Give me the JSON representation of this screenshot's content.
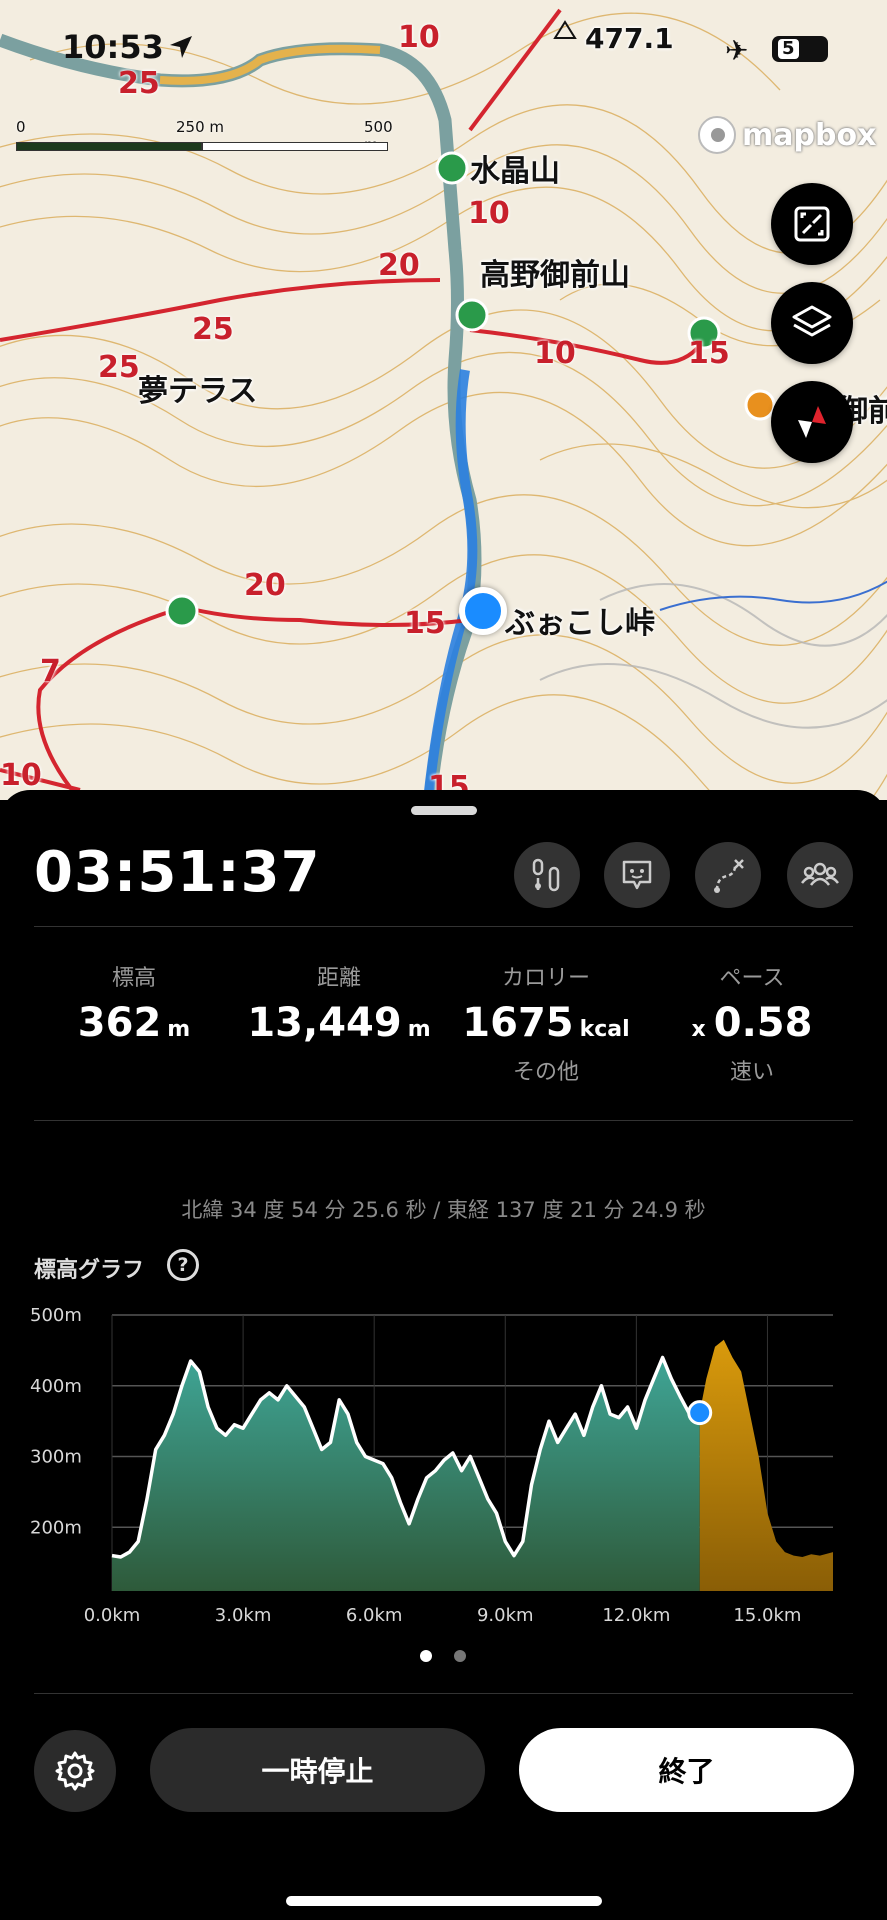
{
  "status_bar": {
    "time": "10:53",
    "battery": "5"
  },
  "map": {
    "scale": {
      "tick_0": "0",
      "tick_250": "250 m",
      "tick_500": "500 m"
    },
    "attribution": "mapbox",
    "peak_elevation": "477.1",
    "places": {
      "suisho_yama": "水晶山",
      "koya_gozen_yama": "高野御前山",
      "yume_terrace": "夢テラス",
      "bukkoshi_toge": "ぶぉこし峠",
      "edge_label": "高野御前"
    },
    "trail_times": [
      "25",
      "10",
      "10",
      "20",
      "25",
      "25",
      "10",
      "15",
      "20",
      "15",
      "7",
      "10",
      "15"
    ],
    "buttons": {
      "expand": "expand-icon",
      "layers": "layers-icon",
      "compass": "compass-icon"
    }
  },
  "activity": {
    "elapsed": "03:51:37",
    "tools": [
      "route-markers-icon",
      "speech-face-icon",
      "route-off-icon",
      "group-icon"
    ],
    "stats": [
      {
        "label": "標高",
        "value": "362",
        "unit": "m",
        "sub": ""
      },
      {
        "label": "距離",
        "value": "13,449",
        "unit": "m",
        "sub": ""
      },
      {
        "label": "カロリー",
        "value": "1675",
        "unit": "kcal",
        "sub": "その他"
      },
      {
        "label": "ペース",
        "prefix": "x",
        "value": "0.58",
        "unit": "",
        "sub": "速い"
      }
    ],
    "coordinates": "北緯 34 度 54 分 25.6 秒 / 東経 137 度 21 分 24.9 秒",
    "graph_title": "標高グラフ",
    "help": "?"
  },
  "chart_data": {
    "type": "area",
    "title": "標高グラフ",
    "xlabel": "",
    "ylabel": "",
    "x_unit": "km",
    "y_unit": "m",
    "xlim": [
      0,
      16.5
    ],
    "ylim": [
      110,
      500
    ],
    "x_ticks": [
      "0.0km",
      "3.0km",
      "6.0km",
      "9.0km",
      "12.0km",
      "15.0km"
    ],
    "x_tick_values": [
      0,
      3,
      6,
      9,
      12,
      15
    ],
    "y_ticks": [
      "500m",
      "400m",
      "300m",
      "200m"
    ],
    "y_tick_values": [
      500,
      400,
      300,
      200
    ],
    "grid": true,
    "current_km": 13.45,
    "current_elevation": 362,
    "series": [
      {
        "name": "",
        "color": "#3a9a8f",
        "x": [
          0,
          0.2,
          0.4,
          0.6,
          0.8,
          1.0,
          1.2,
          1.4,
          1.6,
          1.8,
          2.0,
          2.2,
          2.4,
          2.6,
          2.8,
          3.0,
          3.2,
          3.4,
          3.6,
          3.8,
          4.0,
          4.2,
          4.4,
          4.6,
          4.8,
          5.0,
          5.2,
          5.4,
          5.6,
          5.8,
          6.0,
          6.2,
          6.4,
          6.6,
          6.8,
          7.0,
          7.2,
          7.4,
          7.6,
          7.8,
          8.0,
          8.2,
          8.4,
          8.6,
          8.8,
          9.0,
          9.2,
          9.4,
          9.6,
          9.8,
          10.0,
          10.2,
          10.4,
          10.6,
          10.8,
          11.0,
          11.2,
          11.4,
          11.6,
          11.8,
          12.0,
          12.2,
          12.4,
          12.6,
          12.8,
          13.0,
          13.2,
          13.45
        ],
        "y": [
          160,
          158,
          165,
          180,
          240,
          310,
          330,
          360,
          400,
          435,
          420,
          370,
          340,
          330,
          345,
          340,
          360,
          380,
          390,
          380,
          400,
          385,
          370,
          340,
          310,
          320,
          380,
          360,
          320,
          300,
          295,
          290,
          270,
          235,
          205,
          240,
          270,
          280,
          295,
          305,
          280,
          300,
          270,
          240,
          220,
          180,
          160,
          180,
          260,
          310,
          350,
          320,
          340,
          360,
          330,
          370,
          400,
          360,
          355,
          370,
          340,
          380,
          410,
          440,
          410,
          385,
          362,
          362
        ]
      },
      {
        "name": "",
        "color": "#c8900a",
        "x": [
          13.45,
          13.6,
          13.8,
          14.0,
          14.2,
          14.4,
          14.6,
          14.8,
          15.0,
          15.2,
          15.4,
          15.6,
          15.8,
          16.0,
          16.2,
          16.5
        ],
        "y": [
          362,
          410,
          455,
          465,
          440,
          420,
          360,
          300,
          220,
          180,
          165,
          160,
          158,
          162,
          160,
          165
        ]
      }
    ]
  },
  "controls": {
    "pause": "一時停止",
    "end": "終了",
    "settings": "gear-icon"
  }
}
